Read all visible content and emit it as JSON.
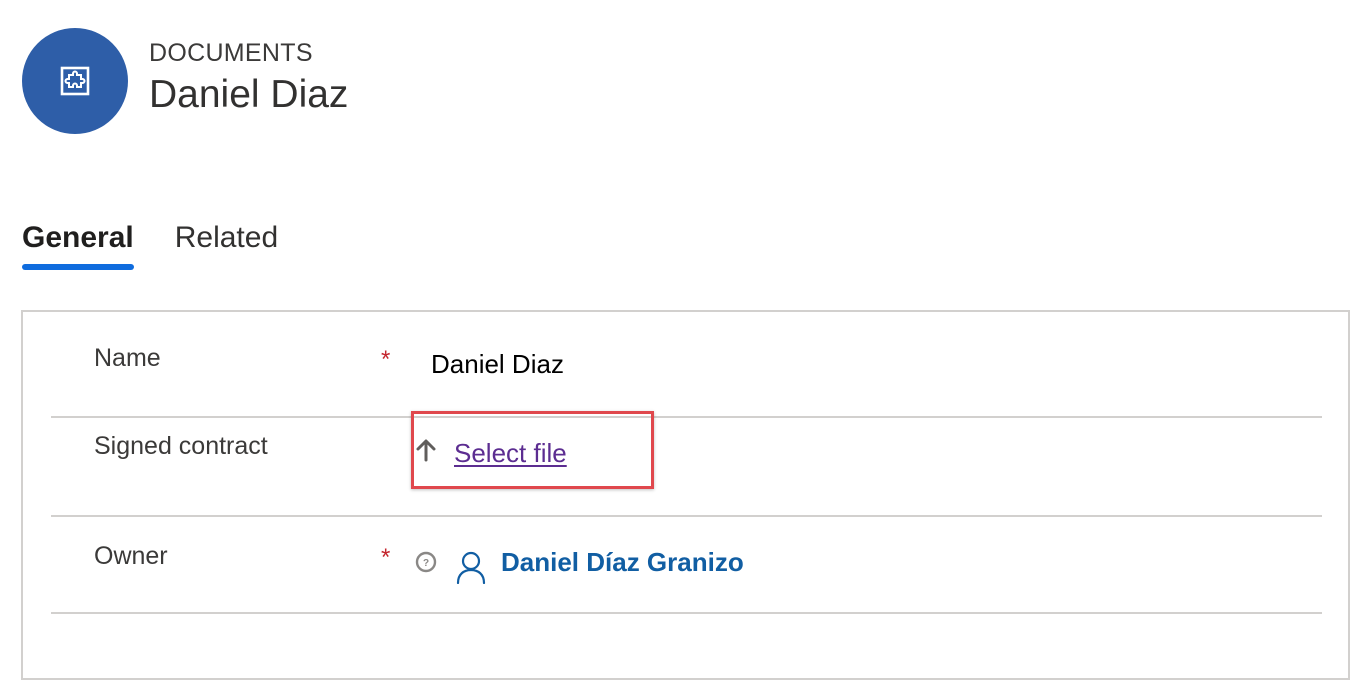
{
  "header": {
    "entity_type": "DOCUMENTS",
    "record_title": "Daniel Diaz",
    "avatar_icon": "puzzle-entity-icon",
    "avatar_color": "#2e5ea8"
  },
  "tabs": [
    {
      "label": "General",
      "active": true
    },
    {
      "label": "Related",
      "active": false
    }
  ],
  "form": {
    "name": {
      "label": "Name",
      "required_marker": "*",
      "value": "Daniel Diaz"
    },
    "signed_contract": {
      "label": "Signed contract",
      "upload_icon": "upload-arrow-icon",
      "action_label": "Select file"
    },
    "owner": {
      "label": "Owner",
      "required_marker": "*",
      "help_icon": "help-circle-icon",
      "user_icon": "person-icon",
      "value": "Daniel Díaz Granizo"
    }
  },
  "colors": {
    "tab_indicator": "#0f6cde",
    "required": "#c4262e",
    "link_visited": "#5c2d91",
    "owner_link": "#115ea3",
    "highlight": "#e0484d"
  }
}
